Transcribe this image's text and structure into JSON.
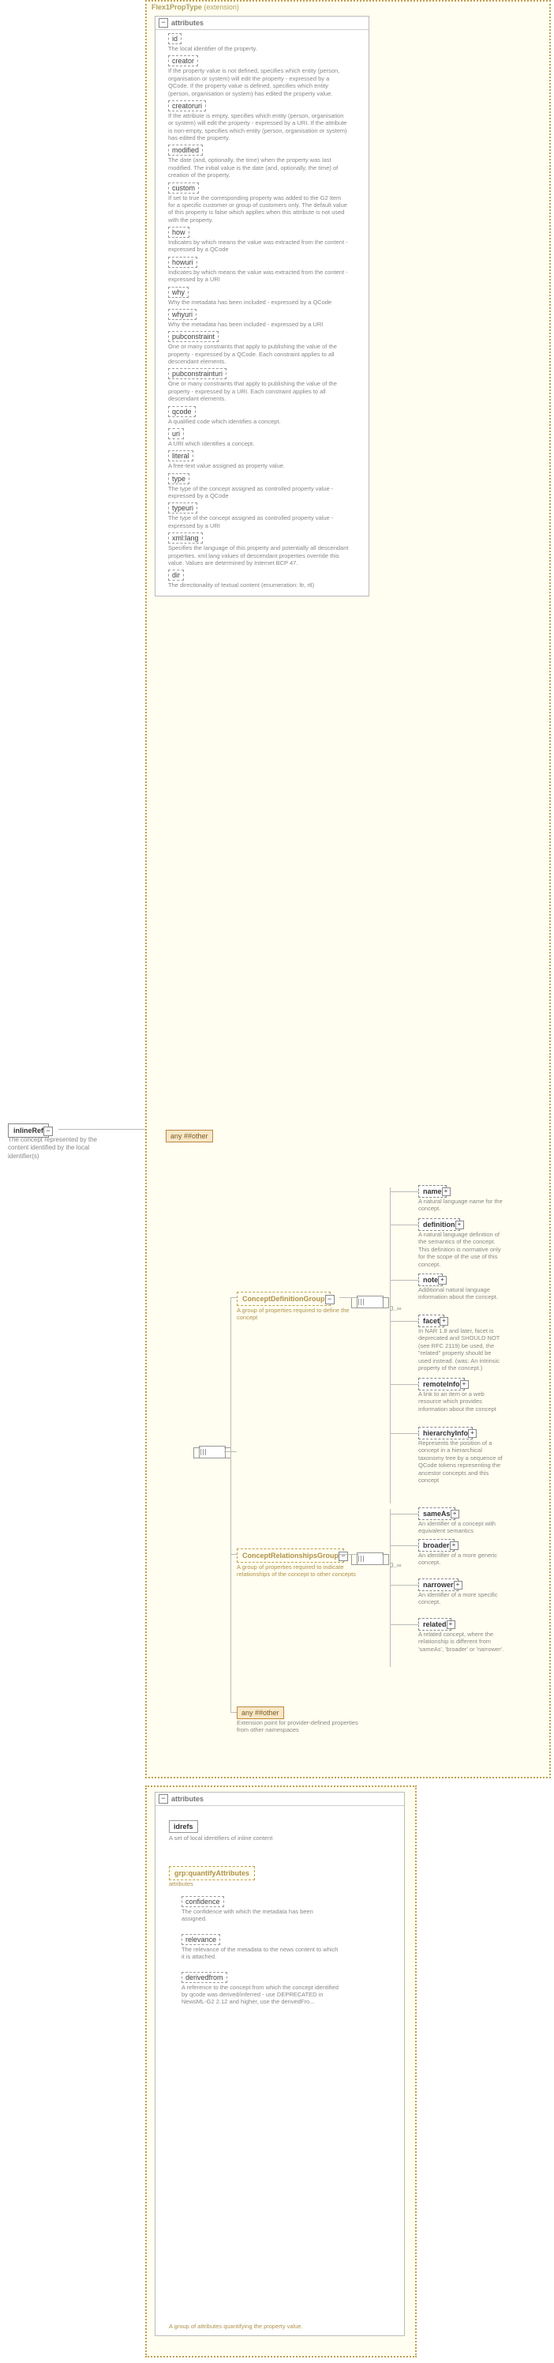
{
  "root": {
    "label": "inlineRef",
    "desc": "The concept represented by the content identified by the local identifier(s)"
  },
  "type": {
    "name": "Flex1PropType",
    "ext": "(extension)"
  },
  "attrPanel": {
    "title": "attributes"
  },
  "attrs": [
    {
      "name": "id",
      "desc": "The local identifier of the property."
    },
    {
      "name": "creator",
      "desc": "If the property value is not defined, specifies which entity (person, organisation or system) will edit the property - expressed by a QCode. If the property value is defined, specifies which entity (person, organisation or system) has edited the property value."
    },
    {
      "name": "creatoruri",
      "desc": "If the attribute is empty, specifies which entity (person, organisation or system) will edit the property - expressed by a URI. If the attribute is non-empty, specifies which entity (person, organisation or system) has edited the property."
    },
    {
      "name": "modified",
      "desc": "The date (and, optionally, the time) when the property was last modified. The initial value is the date (and, optionally, the time) of creation of the property."
    },
    {
      "name": "custom",
      "desc": "If set to true the corresponding property was added to the G2 Item for a specific customer or group of customers only. The default value of this property is false which applies when this attribute is not used with the property."
    },
    {
      "name": "how",
      "desc": "Indicates by which means the value was extracted from the content - expressed by a QCode"
    },
    {
      "name": "howuri",
      "desc": "Indicates by which means the value was extracted from the content - expressed by a URI"
    },
    {
      "name": "why",
      "desc": "Why the metadata has been included - expressed by a QCode"
    },
    {
      "name": "whyuri",
      "desc": "Why the metadata has been included - expressed by a URI"
    },
    {
      "name": "pubconstraint",
      "desc": "One or many constraints that apply to publishing the value of the property - expressed by a QCode. Each constraint applies to all descendant elements."
    },
    {
      "name": "pubconstrainturi",
      "desc": "One or many constraints that apply to publishing the value of the property - expressed by a URI. Each constraint applies to all descendant elements."
    },
    {
      "name": "qcode",
      "desc": "A qualified code which identifies a concept."
    },
    {
      "name": "uri",
      "desc": "A URI which identifies a concept."
    },
    {
      "name": "literal",
      "desc": "A free-text value assigned as property value."
    },
    {
      "name": "type",
      "desc": "The type of the concept assigned as controlled property value - expressed by a QCode"
    },
    {
      "name": "typeuri",
      "desc": "The type of the concept assigned as controlled property value - expressed by a URI"
    },
    {
      "name": "xml:lang",
      "desc": "Specifies the language of this property and potentially all descendant properties. xml:lang values of descendant properties override this value. Values are determined by Internet BCP 47."
    },
    {
      "name": "dir",
      "desc": "The directionality of textual content (enumeration: ltr, rtl)"
    }
  ],
  "anyOther": "any ##other",
  "groups": {
    "cdg": {
      "name": "ConceptDefinitionGroup",
      "desc": "A group of properties required to define the concept"
    },
    "crg": {
      "name": "ConceptRelationshipsGroup",
      "desc": "A group of properties required to indicate relationships of the concept to other concepts"
    }
  },
  "cdgElems": [
    {
      "name": "name",
      "desc": "A natural language name for the concept."
    },
    {
      "name": "definition",
      "desc": "A natural language definition of the semantics of the concept. This definition is normative only for the scope of the use of this concept."
    },
    {
      "name": "note",
      "desc": "Additional natural language information about the concept."
    },
    {
      "name": "facet",
      "desc": "In NAR 1.8 and later, facet is deprecated and SHOULD NOT (see RFC 2119) be used, the \"related\" property should be used instead. (was: An intrinsic property of the concept.)"
    },
    {
      "name": "remoteInfo",
      "desc": "A link to an item or a web resource which provides information about the concept"
    },
    {
      "name": "hierarchyInfo",
      "desc": "Represents the position of a concept in a hierarchical taxonomy tree by a sequence of QCode tokens representing the ancestor concepts and this concept"
    }
  ],
  "crgElems": [
    {
      "name": "sameAs",
      "desc": "An identifier of a concept with equivalent semantics"
    },
    {
      "name": "broader",
      "desc": "An identifier of a more generic concept."
    },
    {
      "name": "narrower",
      "desc": "An identifier of a more specific concept."
    },
    {
      "name": "related",
      "desc": "A related concept, where the relationship is different from 'sameAs', 'broader' or 'narrower'."
    }
  ],
  "seqCount": "0..∞",
  "extDesc": "Extension point for provider-defined properties from other namespaces",
  "lower": {
    "idrefs": {
      "name": "idrefs",
      "desc": "A set of local identifiers of inline content"
    },
    "qa": {
      "prefix": "grp:",
      "name": "quantifyAttributes",
      "desc": "attributes"
    },
    "qaItems": [
      {
        "name": "confidence",
        "desc": "The confidence with which the metadata has been assigned."
      },
      {
        "name": "relevance",
        "desc": "The relevance of the metadata to the news content to which it is attached."
      },
      {
        "name": "derivedfrom",
        "desc": "A reference to the concept from which the concept identified by qcode was derived/inferred - use DEPRECATED in NewsML-G2 2.12 and higher, use the derivedFro..."
      }
    ],
    "qaFooter": "A group of attributes quantifying the property value."
  }
}
